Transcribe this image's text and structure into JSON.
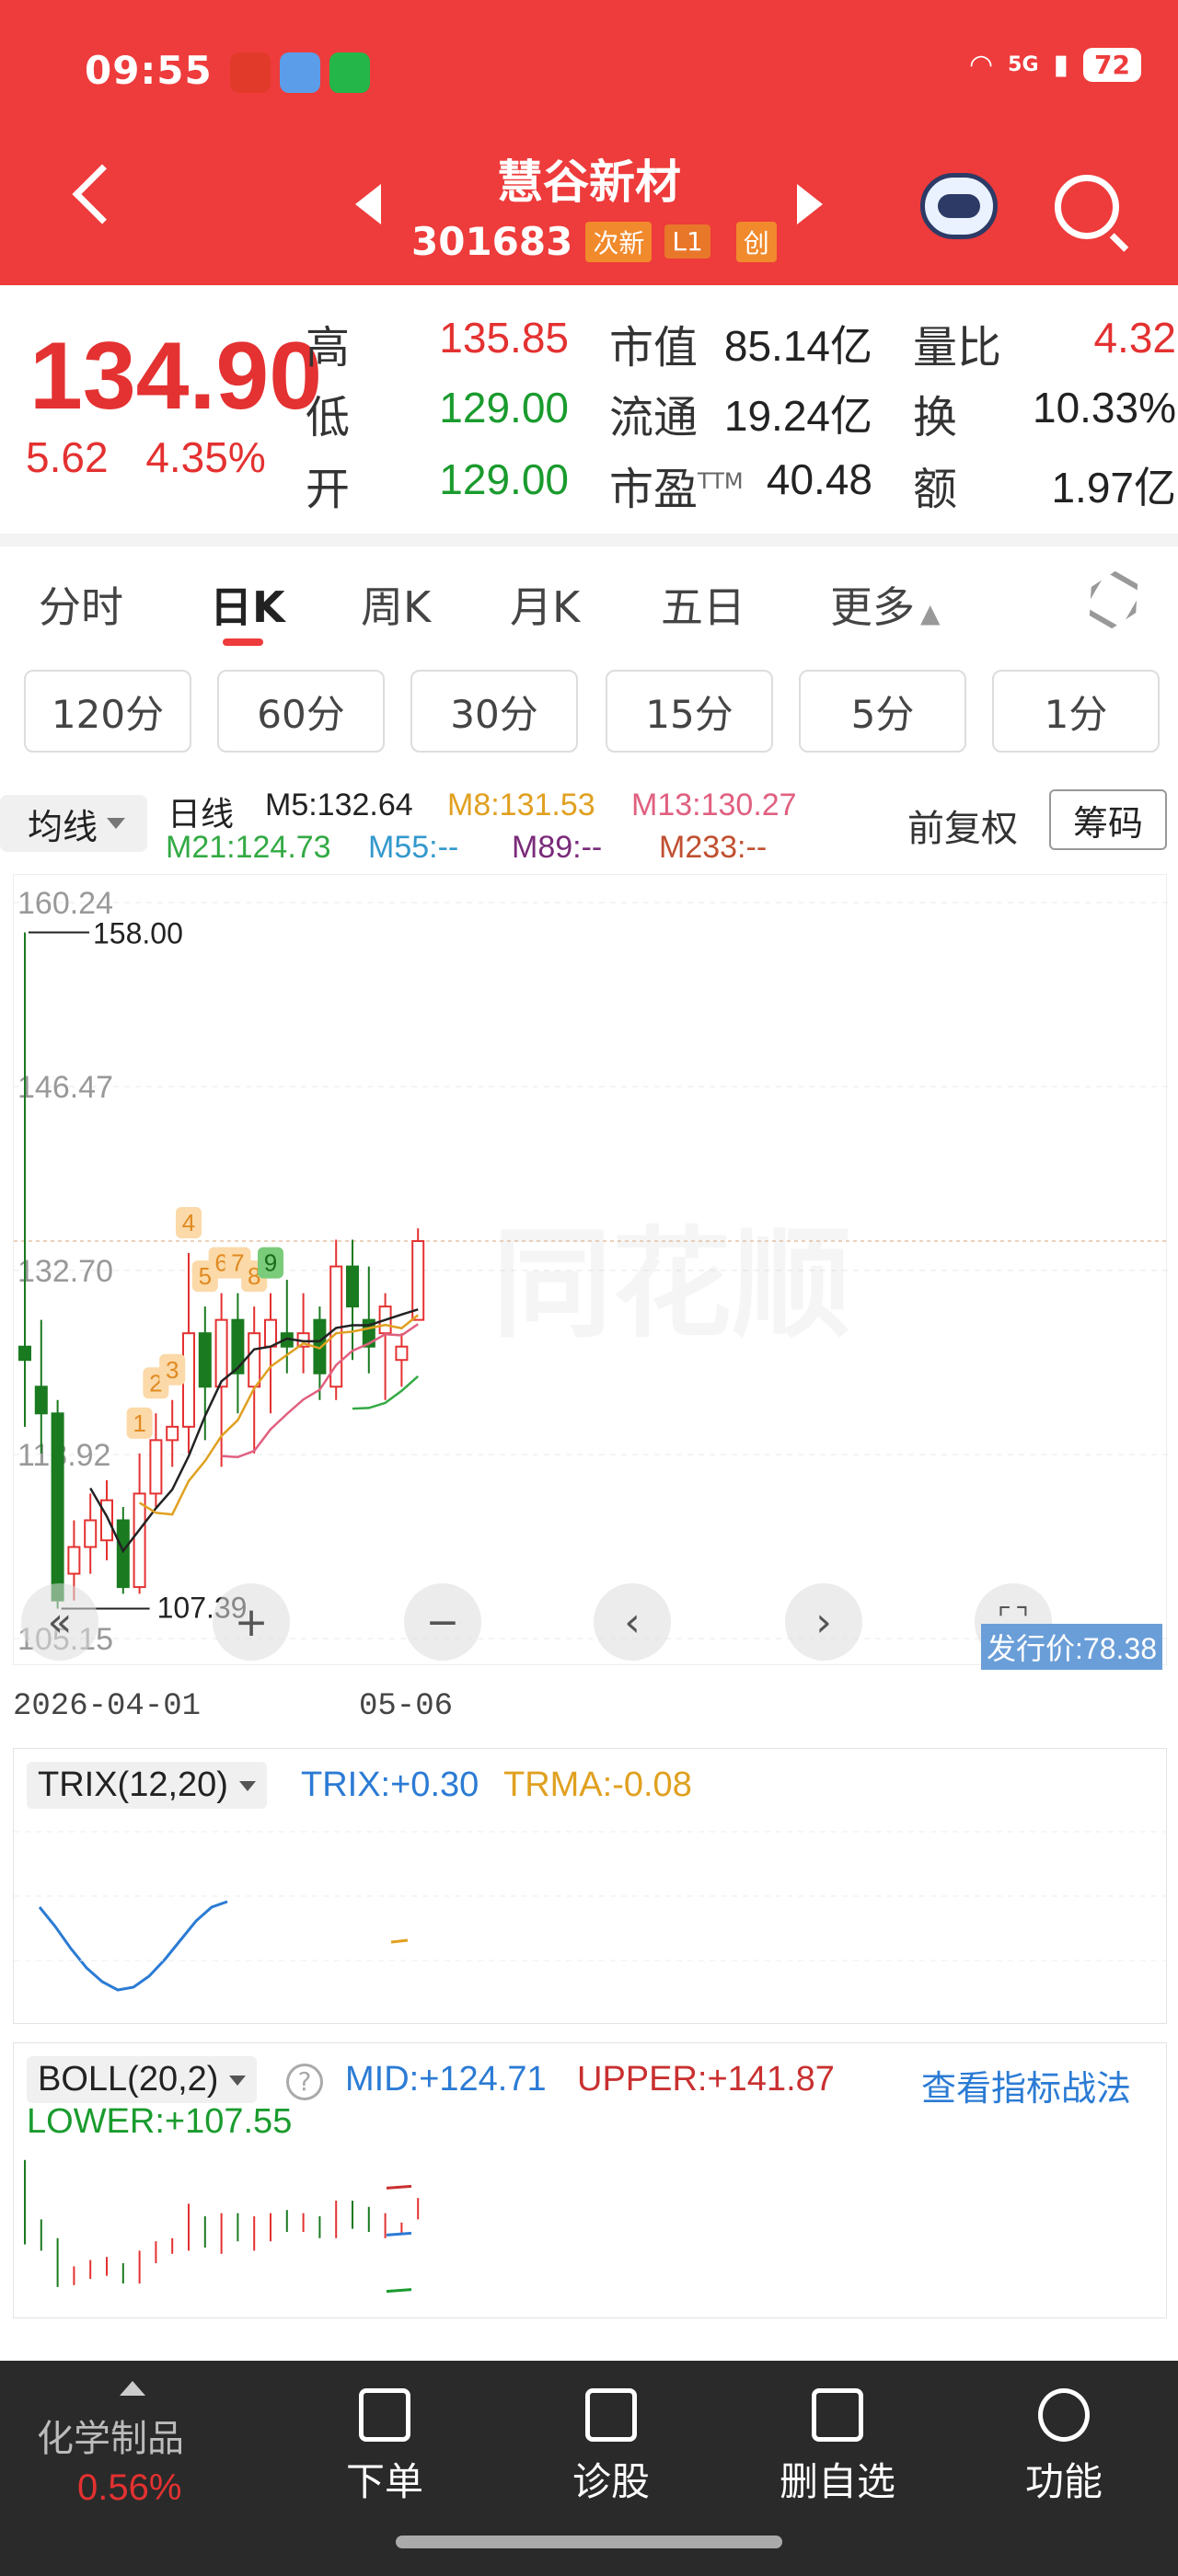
{
  "status_bar": {
    "time": "09:55",
    "battery": "72",
    "network": "5G"
  },
  "header": {
    "stock_name": "慧谷新材",
    "stock_code": "301683",
    "tags": [
      "次新",
      "L1",
      "创"
    ]
  },
  "quote": {
    "price": "134.90",
    "change": "5.62",
    "change_pct": "4.35%",
    "fields": [
      {
        "label": "高",
        "value": "135.85"
      },
      {
        "label": "低",
        "value": "129.00"
      },
      {
        "label": "开",
        "value": "129.00"
      },
      {
        "label": "市值",
        "value": "85.14亿"
      },
      {
        "label": "流通",
        "value": "19.24亿"
      },
      {
        "label": "市盈",
        "sup": "TTM",
        "value": "40.48"
      },
      {
        "label": "量比",
        "value": "4.32"
      },
      {
        "label": "换",
        "value": "10.33%"
      },
      {
        "label": "额",
        "value": "1.97亿"
      }
    ]
  },
  "tabs": [
    "分时",
    "日K",
    "周K",
    "月K",
    "五日",
    "更多"
  ],
  "intervals": [
    "120分",
    "60分",
    "30分",
    "15分",
    "5分",
    "1分"
  ],
  "ma_legend": {
    "selector": "均线",
    "period": "日线",
    "fq": "前复权",
    "chouma": "筹码",
    "items": [
      {
        "text": "M5:132.64",
        "color": "#222222"
      },
      {
        "text": "M8:131.53",
        "color": "#e0a020"
      },
      {
        "text": "M13:130.27",
        "color": "#e06080"
      },
      {
        "text": "M21:124.73",
        "color": "#33aa44"
      },
      {
        "text": "M55:--",
        "color": "#3399cc"
      },
      {
        "text": "M89:--",
        "color": "#7a2a7a"
      },
      {
        "text": "M233:--",
        "color": "#c05030"
      }
    ]
  },
  "chart_data": {
    "type": "candlestick",
    "y_ticks": [
      "160.24",
      "146.47",
      "132.70",
      "118.92",
      "105.15"
    ],
    "max_label": "158.00",
    "min_label": "107.39",
    "ipo_price": "发行价:78.38",
    "last_price": 134.9,
    "date_start": "2026-04-01",
    "date_end": "05-06",
    "td_marks": [
      "1",
      "2",
      "3",
      "4",
      "5",
      "6",
      "7",
      "8",
      "9"
    ],
    "candles": [
      {
        "o": 127,
        "c": 126,
        "h": 158,
        "l": 121
      },
      {
        "o": 124,
        "c": 122,
        "h": 129,
        "l": 119
      },
      {
        "o": 122,
        "c": 108,
        "h": 123,
        "l": 107.39
      },
      {
        "o": 110,
        "c": 112,
        "h": 114,
        "l": 108
      },
      {
        "o": 112,
        "c": 114,
        "h": 116,
        "l": 110
      },
      {
        "o": 112.5,
        "c": 115.5,
        "h": 117,
        "l": 111
      },
      {
        "o": 114,
        "c": 109,
        "h": 115,
        "l": 108.5
      },
      {
        "o": 109,
        "c": 116,
        "h": 119,
        "l": 108.5
      },
      {
        "o": 116,
        "c": 120,
        "h": 122,
        "l": 115
      },
      {
        "o": 120,
        "c": 121,
        "h": 123,
        "l": 118
      },
      {
        "o": 121,
        "c": 128,
        "h": 134,
        "l": 119
      },
      {
        "o": 128,
        "c": 124,
        "h": 130,
        "l": 120
      },
      {
        "o": 124,
        "c": 129,
        "h": 131,
        "l": 118
      },
      {
        "o": 129,
        "c": 125,
        "h": 131,
        "l": 122
      },
      {
        "o": 124,
        "c": 128,
        "h": 130,
        "l": 119
      },
      {
        "o": 127,
        "c": 129,
        "h": 131,
        "l": 122
      },
      {
        "o": 128,
        "c": 127,
        "h": 132,
        "l": 125
      },
      {
        "o": 127,
        "c": 128,
        "h": 131,
        "l": 125
      },
      {
        "o": 129,
        "c": 125,
        "h": 130,
        "l": 123
      },
      {
        "o": 124,
        "c": 133,
        "h": 135,
        "l": 123
      },
      {
        "o": 133,
        "c": 130,
        "h": 135,
        "l": 126
      },
      {
        "o": 129,
        "c": 127,
        "h": 133,
        "l": 125
      },
      {
        "o": 128,
        "c": 130,
        "h": 131,
        "l": 123
      },
      {
        "o": 126,
        "c": 127,
        "h": 128,
        "l": 124
      },
      {
        "o": 129,
        "c": 134.9,
        "h": 135.85,
        "l": 129
      }
    ]
  },
  "chart_controls": [
    "«",
    "+",
    "−",
    "‹",
    "›",
    "⛶"
  ],
  "trix": {
    "name": "TRIX(12,20)",
    "trix": "TRIX:+0.30",
    "trma": "TRMA:-0.08"
  },
  "boll": {
    "name": "BOLL(20,2)",
    "mid": "MID:+124.71",
    "upper": "UPPER:+141.87",
    "lower": "LOWER:+107.55",
    "strategy": "查看指标战法"
  },
  "bottom_bar": {
    "category": "化学制品",
    "category_pct": "0.56%",
    "items": [
      {
        "label": "下单",
        "icon": "order-icon"
      },
      {
        "label": "诊股",
        "icon": "diagnose-icon"
      },
      {
        "label": "删自选",
        "icon": "remove-watchlist-icon"
      },
      {
        "label": "功能",
        "icon": "menu-icon"
      }
    ]
  },
  "colors": {
    "brand": "#ee3b3b",
    "up": "#e43131",
    "down": "#1a9b2e"
  }
}
